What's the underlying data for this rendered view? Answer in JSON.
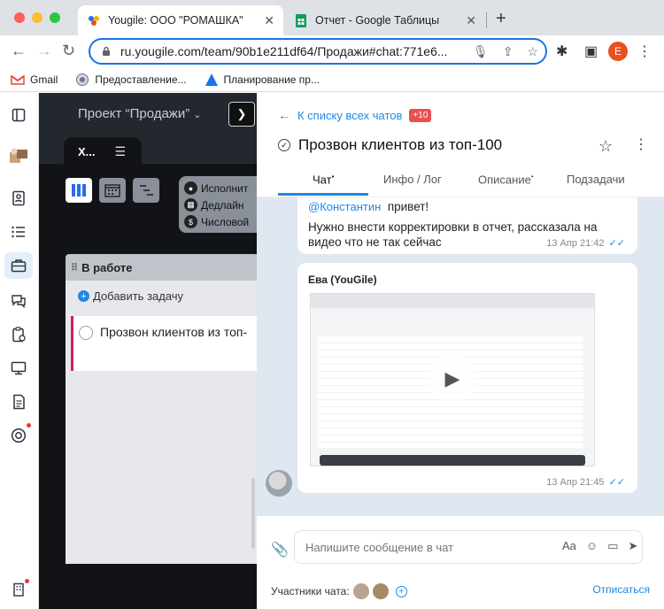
{
  "browser": {
    "tabs": [
      {
        "title": "Yougile: ООО \"РОМАШКА\"",
        "active": true
      },
      {
        "title": "Отчет - Google Таблицы",
        "active": false
      }
    ],
    "url": "ru.yougile.com/team/90b1e211df64/Продажи#chat:771e6...",
    "profile_initial": "E",
    "bookmarks": [
      "Gmail",
      "Предоставление...",
      "Планирование пр..."
    ]
  },
  "rail": {
    "icons": [
      "sidebar-toggle-icon",
      "company-logo-icon",
      "contacts-icon",
      "list-icon",
      "briefcase-icon",
      "chat-icon",
      "clipboard-icon",
      "monitor-icon",
      "document-icon",
      "support-icon",
      "building-icon"
    ]
  },
  "board": {
    "project_title": "Проект “Продажи”",
    "tab_label": "Х...",
    "filters": [
      "Исполнит",
      "Дедлайн",
      "Числовой"
    ],
    "column_title": "В работе",
    "add_task": "Добавить задачу",
    "task": "Прозвон клиентов из топ-"
  },
  "chat": {
    "back_label": "К списку всех чатов",
    "back_badge": "+10",
    "title": "Прозвон клиентов из топ-100",
    "tabs": [
      {
        "label": "Чат",
        "dot": true
      },
      {
        "label": "Инфо / Лог",
        "dot": false
      },
      {
        "label": "Описание",
        "dot": true
      },
      {
        "label": "Подзадачи",
        "dot": false
      }
    ],
    "messages": [
      {
        "mention": "@Константин",
        "text_first": "привет!",
        "text": "Нужно внести корректировки в отчет, рассказала на видео что не так сейчас",
        "time": "13 Апр 21:42"
      },
      {
        "author": "Ева (YouGile)",
        "time": "13 Апр 21:45"
      }
    ],
    "input_placeholder": "Напишите сообщение в чат",
    "participants_label": "Участники чата:",
    "unsubscribe": "Отписаться"
  }
}
